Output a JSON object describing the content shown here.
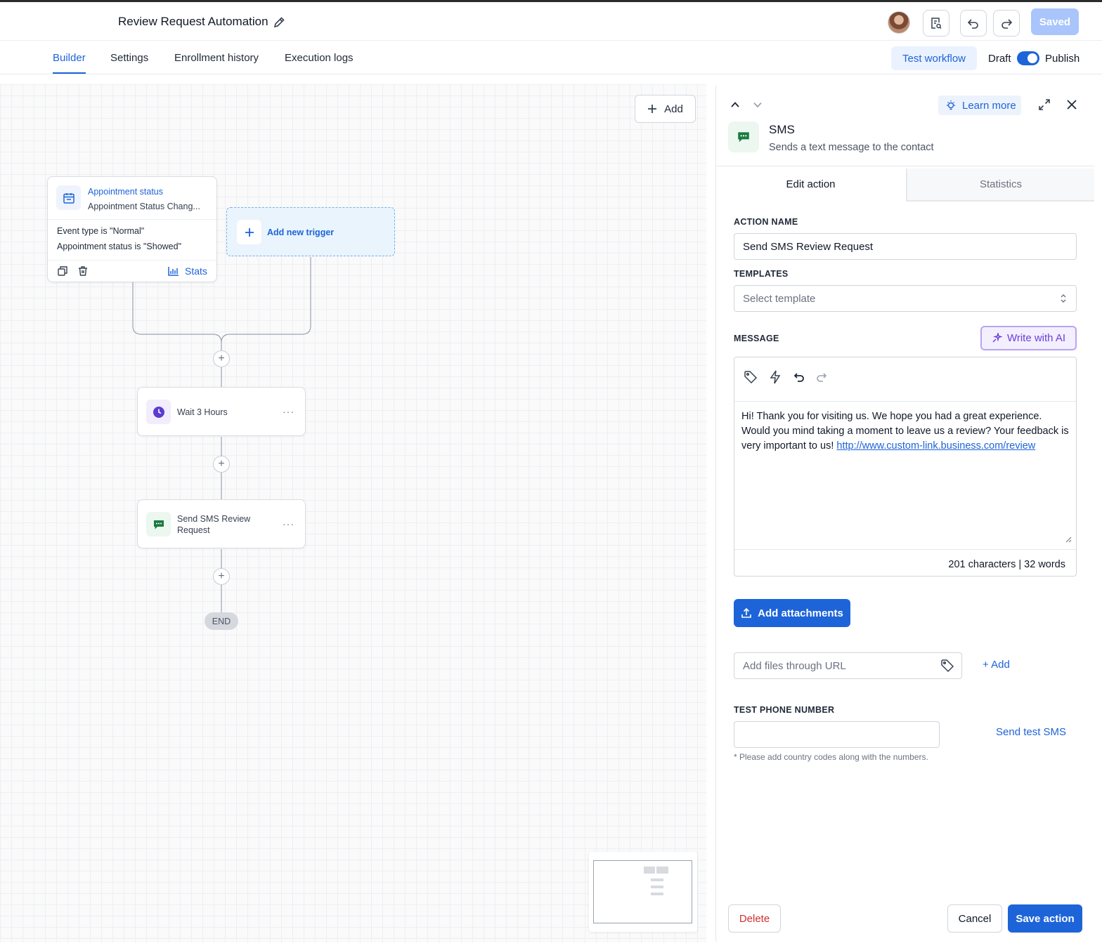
{
  "header": {
    "workflow_title": "Review Request Automation",
    "saved_label": "Saved"
  },
  "tabs": [
    {
      "label": "Builder",
      "active": true
    },
    {
      "label": "Settings"
    },
    {
      "label": "Enrollment history"
    },
    {
      "label": "Execution logs"
    }
  ],
  "toolbar": {
    "test_workflow_label": "Test workflow",
    "draft_label": "Draft",
    "publish_label": "Publish",
    "publish_toggle_on": true
  },
  "canvas": {
    "add_label": "Add",
    "trigger": {
      "title": "Appointment status",
      "subtitle": "Appointment Status Chang...",
      "conditions": [
        "Event type is \"Normal\"",
        "Appointment status is \"Showed\""
      ],
      "stats_label": "Stats"
    },
    "add_trigger_label": "Add new trigger",
    "steps": [
      {
        "label": "Wait 3 Hours",
        "icon": "clock-icon"
      },
      {
        "label": "Send SMS Review Request",
        "icon": "sms-icon"
      }
    ],
    "end_label": "END"
  },
  "panel": {
    "learn_more_label": "Learn more",
    "action_type": "SMS",
    "action_description": "Sends a text message to the contact",
    "tabs": [
      "Edit action",
      "Statistics"
    ],
    "action_name_label": "ACTION NAME",
    "action_name_value": "Send SMS Review Request",
    "templates_label": "TEMPLATES",
    "templates_placeholder": "Select template",
    "message_label": "MESSAGE",
    "write_ai_label": "Write with AI",
    "message_text": "Hi! Thank you for visiting us. We hope you had a great experience. Would you mind taking a moment to leave us a review? Your feedback is very important to us! ",
    "message_link": "http://www.custom-link.business.com/review",
    "char_count": "201 characters",
    "word_count": "32 words",
    "add_attachments_label": "Add attachments",
    "url_placeholder": "Add files through URL",
    "url_add_label": "+ Add",
    "test_phone_label": "TEST PHONE NUMBER",
    "send_test_label": "Send test SMS",
    "phone_hint": "* Please add country codes along with the numbers.",
    "delete_label": "Delete",
    "cancel_label": "Cancel",
    "save_label": "Save action"
  },
  "colors": {
    "primary": "#1d64d8",
    "sms_green": "#1a8a4a",
    "wait_purple": "#5b3bd1",
    "ai_purple": "#6b3fd6",
    "danger": "#d32f2f"
  }
}
